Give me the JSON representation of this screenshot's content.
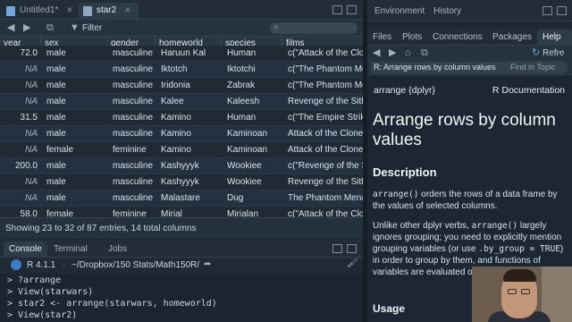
{
  "source_tabs": [
    {
      "label": "Untitled1*",
      "active": false
    },
    {
      "label": "star2",
      "active": true
    }
  ],
  "data_toolbar": {
    "filter_label": "Filter"
  },
  "grid": {
    "columns": [
      "year",
      "sex",
      "gender",
      "homeworld",
      "species",
      "films"
    ],
    "rows": [
      {
        "year": "72.0",
        "sex": "male",
        "gender": "masculine",
        "homeworld": "Haruun Kal",
        "species": "Human",
        "films": "c(\"Attack of the Clone"
      },
      {
        "year": "NA",
        "sex": "male",
        "gender": "masculine",
        "homeworld": "Iktotch",
        "species": "Iktotchi",
        "films": "c(\"The Phantom Me"
      },
      {
        "year": "NA",
        "sex": "male",
        "gender": "masculine",
        "homeworld": "Iridonia",
        "species": "Zabrak",
        "films": "c(\"The Phantom Me"
      },
      {
        "year": "NA",
        "sex": "male",
        "gender": "masculine",
        "homeworld": "Kalee",
        "species": "Kaleesh",
        "films": "Revenge of the Sith"
      },
      {
        "year": "31.5",
        "sex": "male",
        "gender": "masculine",
        "homeworld": "Kamino",
        "species": "Human",
        "films": "c(\"The Empire Strik"
      },
      {
        "year": "NA",
        "sex": "male",
        "gender": "masculine",
        "homeworld": "Kamino",
        "species": "Kaminoan",
        "films": "Attack of the Clone"
      },
      {
        "year": "NA",
        "sex": "female",
        "gender": "feminine",
        "homeworld": "Kamino",
        "species": "Kaminoan",
        "films": "Attack of the Clone"
      },
      {
        "year": "200.0",
        "sex": "male",
        "gender": "masculine",
        "homeworld": "Kashyyyk",
        "species": "Wookiee",
        "films": "c(\"Revenge of the Si"
      },
      {
        "year": "NA",
        "sex": "male",
        "gender": "masculine",
        "homeworld": "Kashyyyk",
        "species": "Wookiee",
        "films": "Revenge of the Sith"
      },
      {
        "year": "NA",
        "sex": "male",
        "gender": "masculine",
        "homeworld": "Malastare",
        "species": "Dug",
        "films": "The Phantom Mena"
      },
      {
        "year": "58.0",
        "sex": "female",
        "gender": "feminine",
        "homeworld": "Mirial",
        "species": "Mirialan",
        "films": "c(\"Attack of the Clon"
      }
    ],
    "status": "Showing 23 to 32 of 87 entries, 14 total columns"
  },
  "console_tabs": [
    {
      "label": "Console",
      "active": true
    },
    {
      "label": "Terminal",
      "active": false
    },
    {
      "label": "Jobs",
      "active": false
    }
  ],
  "console": {
    "r_version": "R 4.1.1",
    "path": "~/Dropbox/150 Stats/Math150R/",
    "lines": [
      "> ?arrange",
      "> View(starwars)",
      "> star2 <- arrange(starwars, homeworld)",
      "> View(star2)"
    ]
  },
  "env_tabs": [
    "Environment",
    "History"
  ],
  "files_tabs": [
    {
      "label": "Files",
      "active": false
    },
    {
      "label": "Plots",
      "active": false
    },
    {
      "label": "Connections",
      "active": false
    },
    {
      "label": "Packages",
      "active": false
    },
    {
      "label": "Help",
      "active": true
    }
  ],
  "help": {
    "refresh_label": "Refre",
    "topic": "R: Arrange rows by column values",
    "find_placeholder": "Find in Topic",
    "pkg": "arrange {dplyr}",
    "rdoc": "R Documentation",
    "title": "Arrange rows by column values",
    "desc_heading": "Description",
    "p1_code": "arrange()",
    "p1_rest": " orders the rows of a data frame by the values of selected columns.",
    "p2_a": "Unlike other dplyr verbs, ",
    "p2_code1": "arrange()",
    "p2_b": " largely ignores grouping; you need to explicitly mention grouping variables (or use ",
    "p2_code2": ".by_group = TRUE",
    "p2_c": ") in order to group by them, and functions of variables are evaluated once per data frame, not",
    "usage_heading": "Usage"
  },
  "colors": {
    "accent": "#4a90d9",
    "bg": "#1c2733",
    "panel": "#222d38"
  }
}
